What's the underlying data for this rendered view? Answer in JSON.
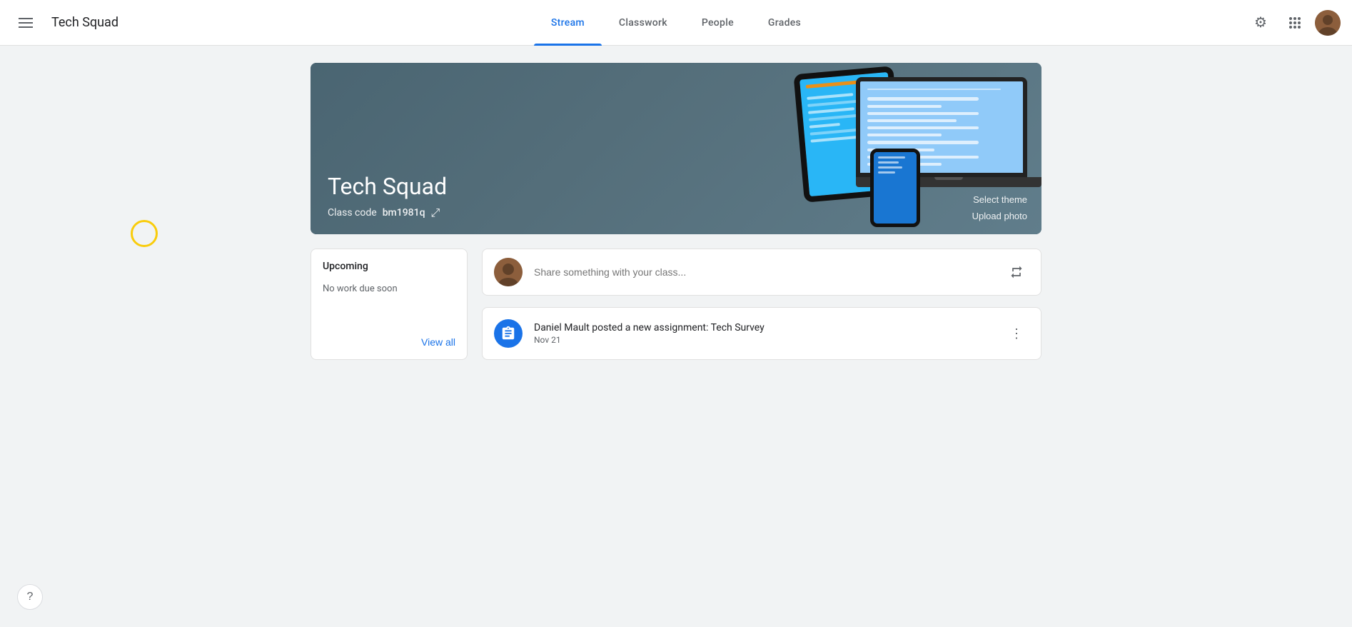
{
  "app": {
    "title": "Tech Squad"
  },
  "topnav": {
    "hamburger_label": "menu",
    "tabs": [
      {
        "id": "stream",
        "label": "Stream",
        "active": true
      },
      {
        "id": "classwork",
        "label": "Classwork",
        "active": false
      },
      {
        "id": "people",
        "label": "People",
        "active": false
      },
      {
        "id": "grades",
        "label": "Grades",
        "active": false
      }
    ]
  },
  "banner": {
    "class_name": "Tech Squad",
    "class_code_label": "Class code",
    "class_code": "bm1981q",
    "select_theme": "Select theme",
    "upload_photo": "Upload photo"
  },
  "upcoming": {
    "title": "Upcoming",
    "no_work": "No work due soon",
    "view_all": "View all"
  },
  "share": {
    "placeholder": "Share something with your class..."
  },
  "assignment": {
    "text": "Daniel Mault posted a new assignment: Tech Survey",
    "date": "Nov 21"
  },
  "help": {
    "label": "?"
  }
}
